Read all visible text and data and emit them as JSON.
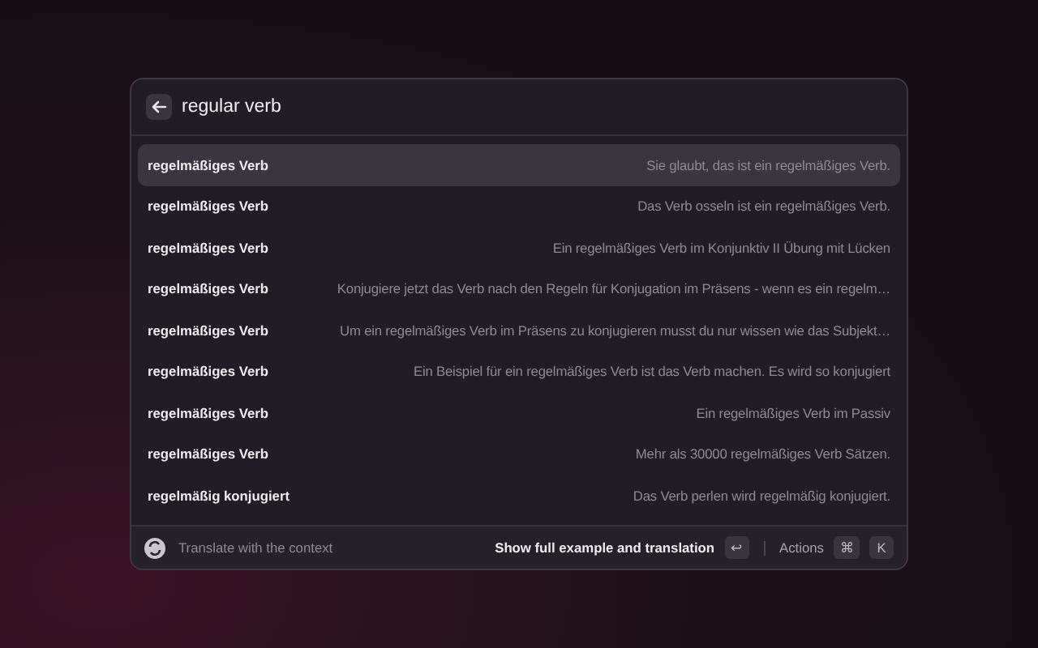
{
  "search": {
    "value": "regular verb"
  },
  "results": [
    {
      "term": "regelmäßiges Verb",
      "example": "Sie glaubt, das ist ein regelmäßiges Verb.",
      "selected": true
    },
    {
      "term": "regelmäßiges Verb",
      "example": "Das Verb osseln ist ein regelmäßiges Verb.",
      "selected": false
    },
    {
      "term": "regelmäßiges Verb",
      "example": "Ein regelmäßiges Verb im Konjunktiv II Übung mit Lücken",
      "selected": false
    },
    {
      "term": "regelmäßiges Verb",
      "example": "Konjugiere jetzt das Verb nach den Regeln für Konjugation im Präsens - wenn es ein regelm…",
      "selected": false
    },
    {
      "term": "regelmäßiges Verb",
      "example": "Um ein regelmäßiges Verb im Präsens zu konjugieren musst du nur wissen wie das Subjekt…",
      "selected": false
    },
    {
      "term": "regelmäßiges Verb",
      "example": "Ein Beispiel für ein regelmäßiges Verb ist das Verb machen. Es wird so konjugiert",
      "selected": false
    },
    {
      "term": "regelmäßiges Verb",
      "example": "Ein regelmäßiges Verb im Passiv",
      "selected": false
    },
    {
      "term": "regelmäßiges Verb",
      "example": "Mehr als 30000 regelmäßiges Verb Sätzen.",
      "selected": false
    },
    {
      "term": "regelmäßig konjugiert",
      "example": "Das Verb perlen wird regelmäßig konjugiert.",
      "selected": false
    }
  ],
  "footer": {
    "title": "Translate with the context",
    "primary_action": "Show full example and translation",
    "primary_key": "↩",
    "actions_label": "Actions",
    "action_keys": [
      "⌘",
      "K"
    ]
  }
}
